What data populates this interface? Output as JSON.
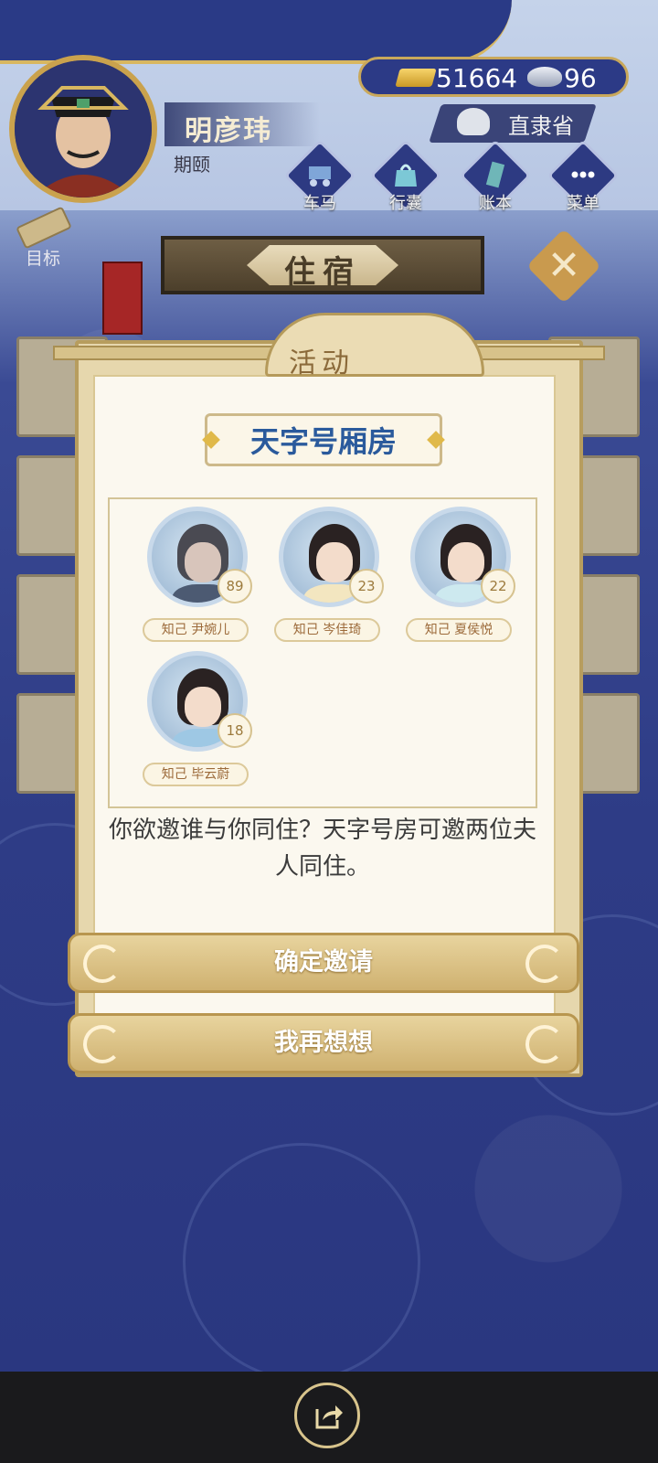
{
  "player": {
    "name": "明彦玮",
    "subtitle": "期颐"
  },
  "currency": {
    "gold": "51664",
    "silver": "96"
  },
  "region": "直隶省",
  "nav": [
    {
      "label": "车马",
      "icon": "carriage-icon"
    },
    {
      "label": "行囊",
      "icon": "bag-icon"
    },
    {
      "label": "账本",
      "icon": "ledger-icon"
    },
    {
      "label": "菜单",
      "icon": "menu-icon"
    }
  ],
  "goal_label": "目标",
  "screen_title": "住宿",
  "dialog": {
    "title": "活动",
    "room_name": "天字号厢房",
    "characters": [
      {
        "tag": "知己 尹婉儿",
        "level": "89"
      },
      {
        "tag": "知己 岑佳琦",
        "level": "23"
      },
      {
        "tag": "知己 夏侯悦",
        "level": "22"
      },
      {
        "tag": "知己 毕云蔚",
        "level": "18"
      }
    ],
    "message": "你欲邀谁与你同住？天字号房可邀两位夫人同住。",
    "confirm_label": "确定邀请",
    "cancel_label": "我再想想"
  },
  "colors": {
    "accent_gold": "#cfb170",
    "room_name_blue": "#2a5a9c",
    "background_navy": "#2e3c86"
  }
}
